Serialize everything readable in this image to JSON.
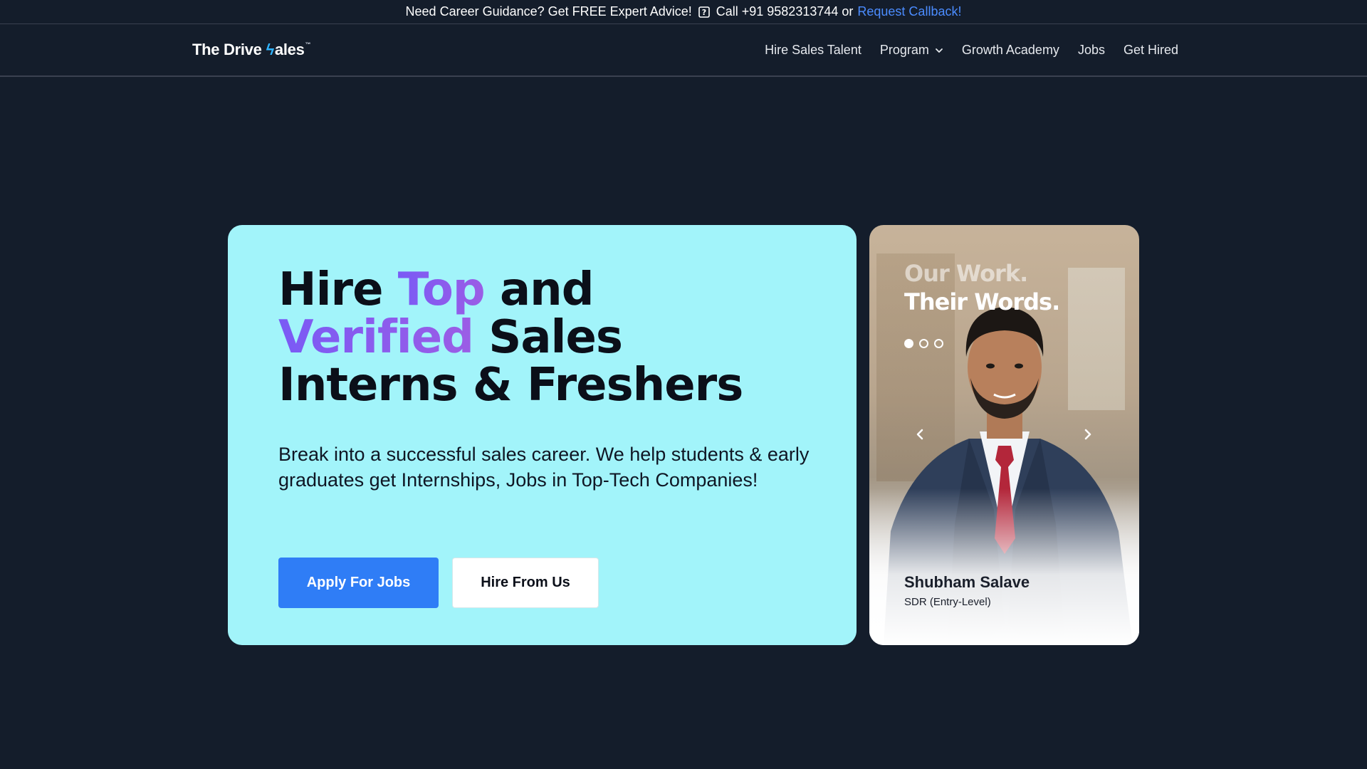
{
  "topbar": {
    "guidance_text": "Need Career Guidance? Get FREE Expert Advice!",
    "call_text": "Call +91 9582313744 or",
    "callback_link": "Request Callback!",
    "link_color": "#4b8cff"
  },
  "nav": {
    "logo_part1": "The Drive",
    "logo_bolt": "ϟ",
    "logo_part2": "ales",
    "logo_tm": "™",
    "items": [
      {
        "label": "Hire Sales Talent"
      },
      {
        "label": "Program",
        "has_dropdown": true
      },
      {
        "label": "Growth Academy"
      },
      {
        "label": "Jobs"
      },
      {
        "label": "Get Hired"
      }
    ]
  },
  "hero": {
    "title_word_hire": "Hire",
    "title_word_top": "Top",
    "title_word_and": "and",
    "title_word_verified": "Verified",
    "title_word_sales": "Sales",
    "title_line3": "Interns & Freshers",
    "subtitle": "Break into a successful sales career. We help students & early graduates get Internships, Jobs in Top-Tech Companies!",
    "primary_button": "Apply For Jobs",
    "secondary_button": "Hire From Us",
    "background_color": "#a2f4fa",
    "primary_color": "#2f7df6",
    "accent_gradient": [
      "#7a5af5",
      "#9b5de5"
    ]
  },
  "testimonial": {
    "heading_line1": "Our Work.",
    "heading_line2": "Their Words.",
    "name": "Shubham Salave",
    "role": "SDR (Entry-Level)",
    "slides": 3,
    "active_slide": 1,
    "icons": [
      "chevron-left-icon",
      "chevron-right-icon"
    ]
  },
  "page": {
    "background_color": "#141d2b"
  }
}
